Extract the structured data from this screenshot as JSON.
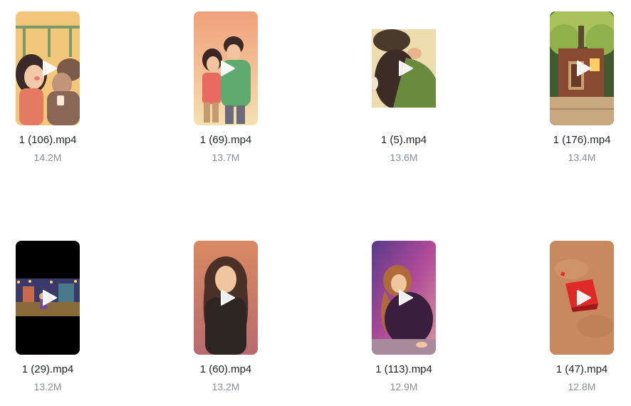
{
  "files": [
    {
      "name": "1 (106).mp4",
      "size": "14.2M",
      "icon": "play-icon"
    },
    {
      "name": "1 (69).mp4",
      "size": "13.7M",
      "icon": "play-icon"
    },
    {
      "name": "1 (5).mp4",
      "size": "13.6M",
      "icon": "play-icon"
    },
    {
      "name": "1 (176).mp4",
      "size": "13.4M",
      "icon": "play-icon"
    },
    {
      "name": "1 (29).mp4",
      "size": "13.2M",
      "icon": "play-icon"
    },
    {
      "name": "1 (60).mp4",
      "size": "13.2M",
      "icon": "play-icon"
    },
    {
      "name": "1 (113).mp4",
      "size": "12.9M",
      "icon": "play-icon"
    },
    {
      "name": "1 (47).mp4",
      "size": "12.8M",
      "icon": "play-icon"
    }
  ],
  "colors": {
    "filename_text": "#1f2329",
    "size_text": "#8a8f99",
    "background": "#ffffff"
  }
}
